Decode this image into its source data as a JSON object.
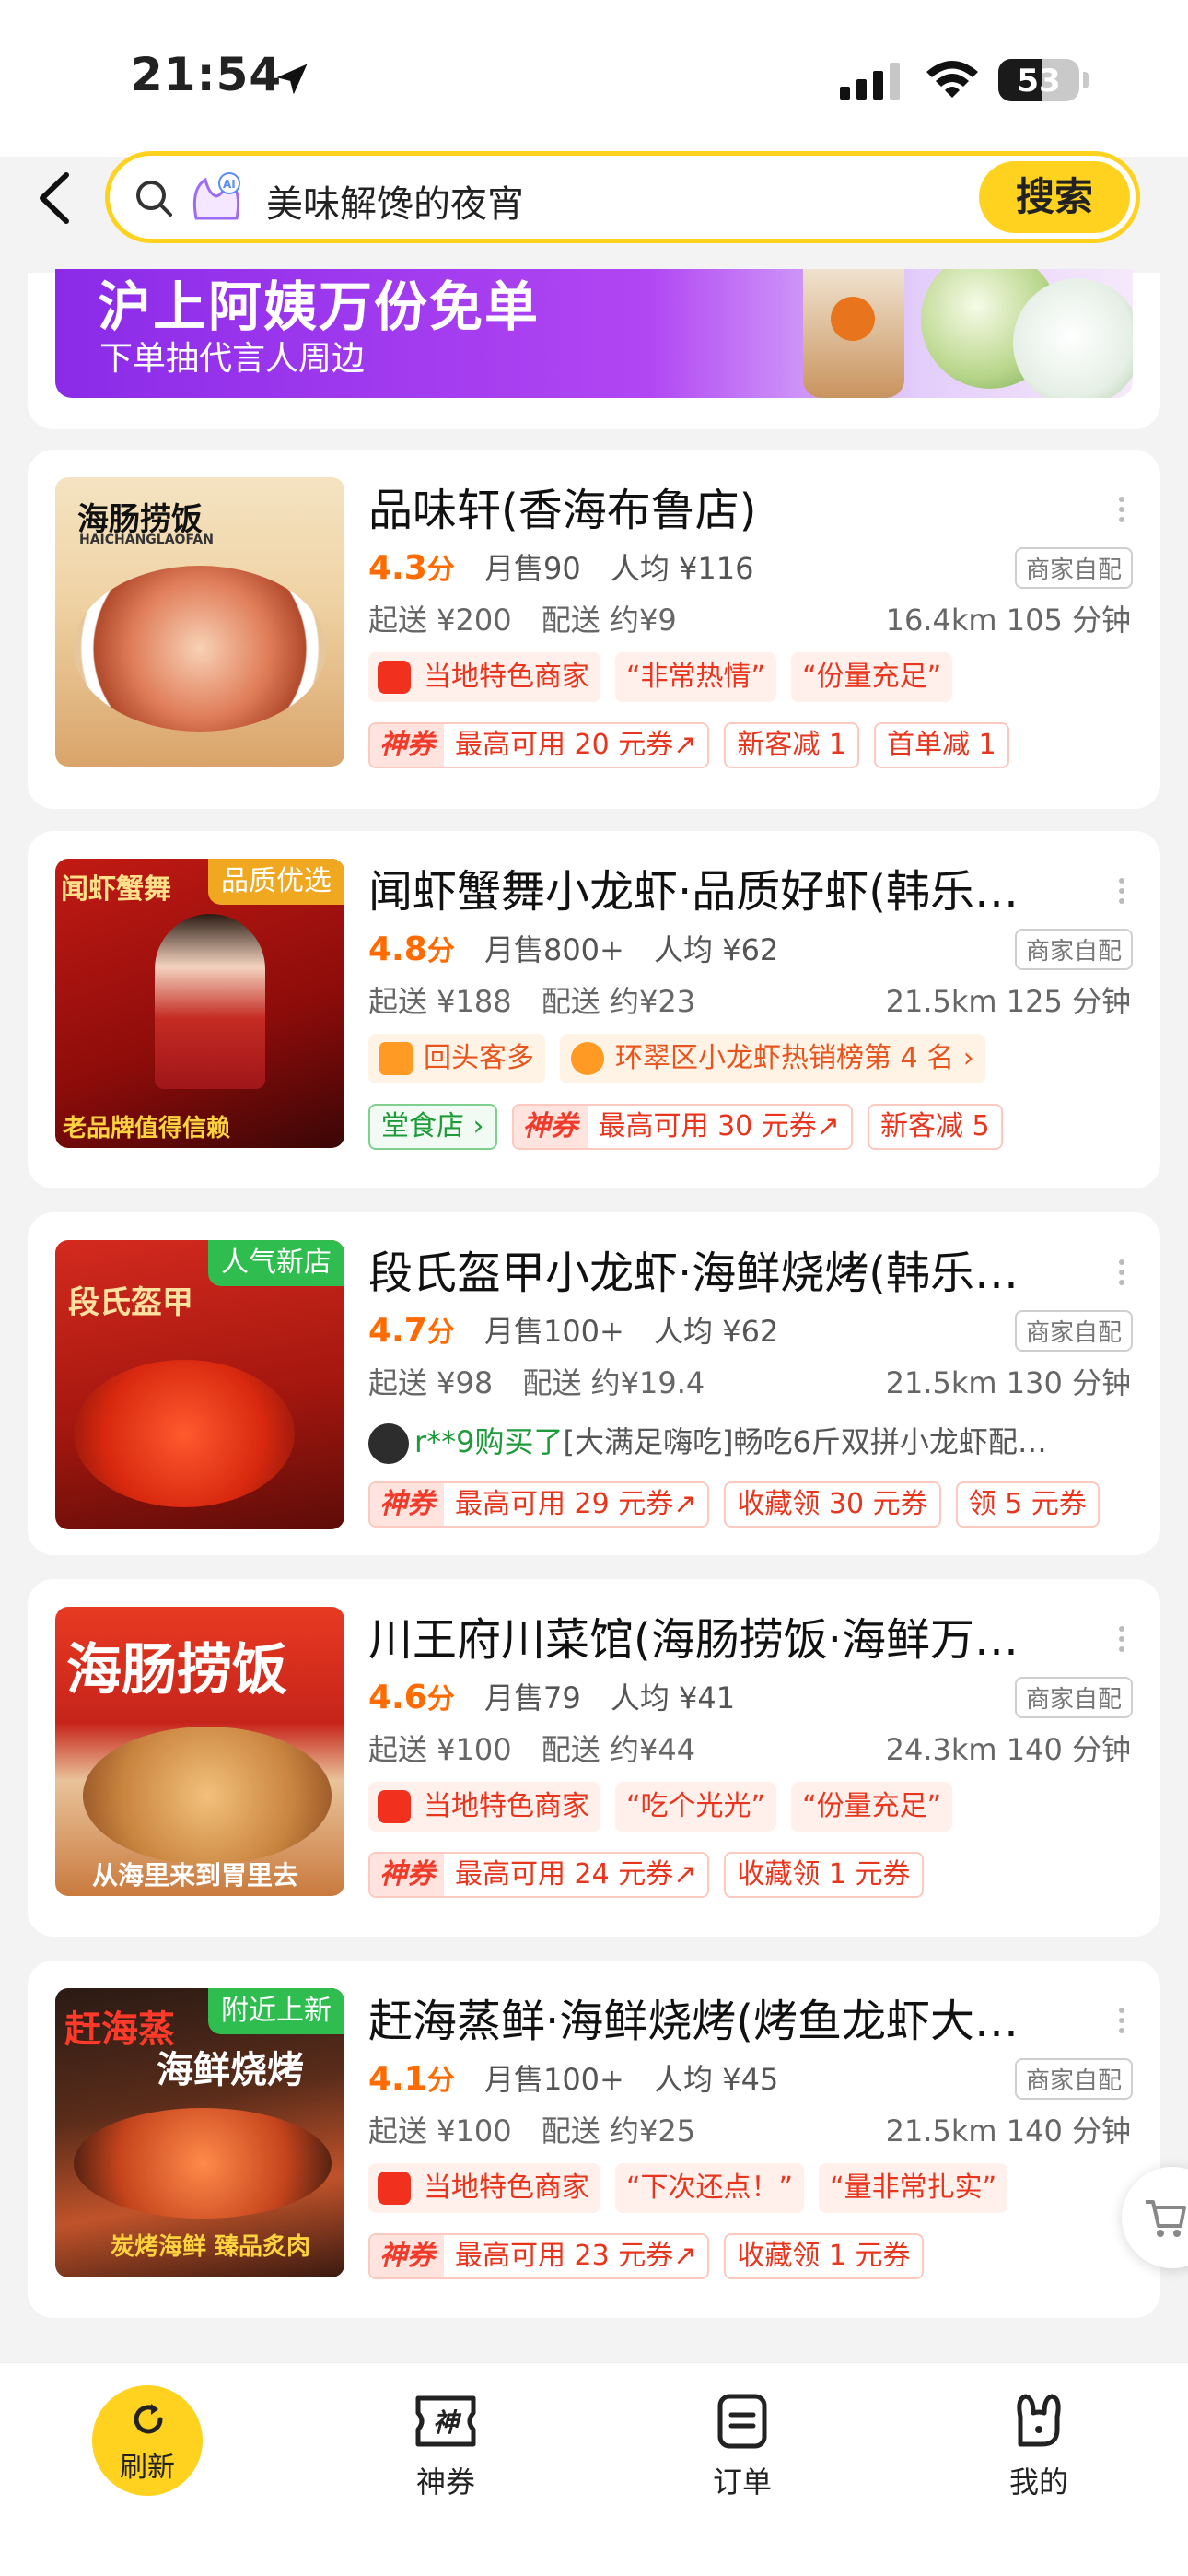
{
  "status": {
    "time": "21:54",
    "battery": "53",
    "battery_level": 0.53
  },
  "search": {
    "query": "美味解馋的夜宵",
    "button": "搜索"
  },
  "banner": {
    "title": "沪上阿姨万份免单",
    "subtitle": "下单抽代言人周边"
  },
  "shops": [
    {
      "name": "品味轩(香海布鲁店)",
      "score": "4.3",
      "score_unit": "分",
      "monthly": "月售90",
      "avg": "人均 ¥116",
      "delivery_badge": "商家自配",
      "min_order": "起送 ¥200",
      "fee": "配送 约¥9",
      "distance": "16.4km",
      "time": "105 分钟",
      "thumb_title": "海肠捞饭",
      "thumb_sub": "HAICHANGLAOFAN",
      "tags_row1": [
        "当地特色商家",
        "“非常热情”",
        "“份量充足”"
      ],
      "coupon": "最高可用 20 元券",
      "tags_row2": [
        "新客减 1",
        "首单减 1"
      ]
    },
    {
      "name": "闻虾蟹舞小龙虾·品质好虾(韩乐…",
      "score": "4.8",
      "score_unit": "分",
      "monthly": "月售800+",
      "avg": "人均 ¥62",
      "delivery_badge": "商家自配",
      "min_order": "起送 ¥188",
      "fee": "配送 约¥23",
      "distance": "21.5km",
      "time": "125 分钟",
      "thumb_tag": "品质优选",
      "thumb_title": "闻虾蟹舞",
      "thumb_bottom": "老品牌值得信赖",
      "tags_row1": [
        "回头客多",
        "环翠区小龙虾热销榜第 4 名 ›"
      ],
      "dine_in": "堂食店 ›",
      "coupon": "最高可用 30 元券",
      "tags_row2": [
        "新客减 5"
      ]
    },
    {
      "name": "段氏盔甲小龙虾·海鲜烧烤(韩乐…",
      "score": "4.7",
      "score_unit": "分",
      "monthly": "月售100+",
      "avg": "人均 ¥62",
      "delivery_badge": "商家自配",
      "min_order": "起送 ¥98",
      "fee": "配送 约¥19.4",
      "distance": "21.5km",
      "time": "130 分钟",
      "thumb_tag": "人气新店",
      "thumb_title": "段氏盔甲",
      "buyer_user": "r**9购买了",
      "buyer_item": "[大满足嗨吃]畅吃6斤双拼小龙虾配…",
      "coupon": "最高可用 29 元券",
      "tags_row2": [
        "收藏领 30 元券",
        "领 5 元券"
      ]
    },
    {
      "name": "川王府川菜馆(海肠捞饭·海鲜万…",
      "score": "4.6",
      "score_unit": "分",
      "monthly": "月售79",
      "avg": "人均 ¥41",
      "delivery_badge": "商家自配",
      "min_order": "起送 ¥100",
      "fee": "配送 约¥44",
      "distance": "24.3km",
      "time": "140 分钟",
      "thumb_title": "海肠捞饭",
      "thumb_bottom": "从海里来到胃里去",
      "tags_row1": [
        "当地特色商家",
        "“吃个光光”",
        "“份量充足”"
      ],
      "coupon": "最高可用 24 元券",
      "tags_row2": [
        "收藏领 1 元券"
      ]
    },
    {
      "name": "赶海蒸鲜·海鲜烧烤(烤鱼龙虾大…",
      "score": "4.1",
      "score_unit": "分",
      "monthly": "月售100+",
      "avg": "人均 ¥45",
      "delivery_badge": "商家自配",
      "min_order": "起送 ¥100",
      "fee": "配送 约¥25",
      "distance": "21.5km",
      "time": "140 分钟",
      "thumb_tag": "附近上新",
      "thumb_title": "赶海蒸",
      "thumb_title2": "海鲜烧烤",
      "thumb_bottom": "炭烤海鲜 臻品炙肉",
      "tags_row1": [
        "当地特色商家",
        "“下次还点！”",
        "“量非常扎实”"
      ],
      "coupon": "最高可用 23 元券",
      "tags_row2": [
        "收藏领 1 元券"
      ]
    }
  ],
  "coupon_prefix": "神券",
  "nav": {
    "refresh": "刷新",
    "coupons": "神券",
    "orders": "订单",
    "mine": "我的"
  },
  "colors": {
    "brand_yellow": "#ffd21f",
    "score_orange": "#ff6b00",
    "tag_red": "#e8361e"
  }
}
